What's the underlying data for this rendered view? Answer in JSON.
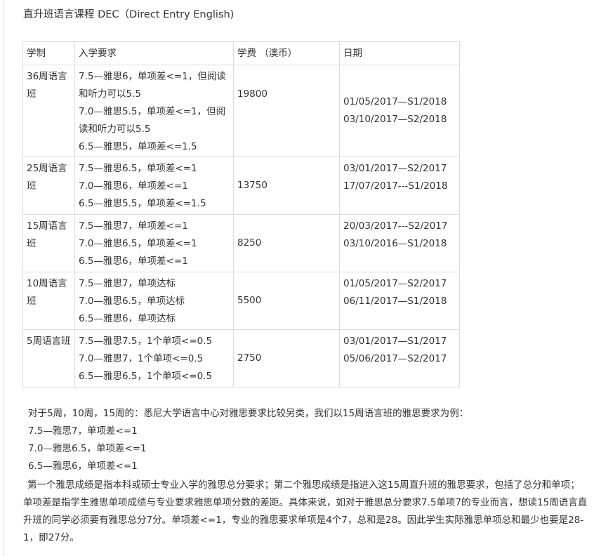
{
  "title": "直升班语言课程 DEC（Direct Entry English)",
  "table": {
    "headers": [
      "学制",
      "入学要求",
      "学费 （澳币）",
      "日期"
    ],
    "rows": [
      {
        "duration": "36周语言班",
        "requirements": [
          "7.5—雅思6，单项差<=1，但阅读和听力可以5.5",
          "7.0—雅思5.5，单项差<=1，但阅读和听力可以5.5",
          "6.5—雅思5，单项差<=1.5"
        ],
        "fee": "19800",
        "dates": [
          "01/05/2017—S1/2018",
          "03/10/2017—S2/2018"
        ]
      },
      {
        "duration": "25周语言班",
        "requirements": [
          "7.5—雅思6.5，单项差<=1",
          "7.0—雅思6，单项差<=1",
          "6.5—雅思5.5，单项差<=1.5"
        ],
        "fee": "13750",
        "dates": [
          "03/01/2017—S2/2017",
          "17/07/2017---S1/2018"
        ]
      },
      {
        "duration": "15周语言班",
        "requirements": [
          "7.5—雅思7，单项差<=1",
          "7.0—雅思6.5，单项差<=1",
          "6.5—雅思6，单项差<=1"
        ],
        "fee": "8250",
        "dates": [
          "20/03/2017---S2/2017",
          "03/10/2016—S1/2018"
        ]
      },
      {
        "duration": "10周语言班",
        "requirements": [
          "7.5—雅思7，单项达标",
          "7.0—雅思6.5，单项达标",
          "6.5—雅思6，单项达标"
        ],
        "fee": "5500",
        "dates": [
          "01/05/2017—S2/2017",
          "06/11/2017—S1/2018"
        ]
      },
      {
        "duration": "5周语言班",
        "requirements": [
          "7.5—雅思7.5，1个单项<=0.5",
          "7.0—雅思7，1个单项<=0.5",
          "6.5—雅思6.5，1个单项<=0.5"
        ],
        "fee": "2750",
        "dates": [
          "03/01/2017—S1/2017",
          "05/06/2017—S2/2017"
        ]
      }
    ]
  },
  "paragraphs": {
    "intro": "对于5周，10周，15周的：悉尼大学语言中心对雅思要求比较另类，我们以15周语言班的雅思要求为例：",
    "example_lines": [
      "7.5—雅思7，单项差<=1",
      "7.0—雅思6.5，单项差<=1",
      "6.5—雅思6，单项差<=1"
    ],
    "explanation": "第一个雅思成绩是指本科或硕士专业入学的雅思总分要求；第二个雅思成绩是指进入这15周直升班的雅思要求，包括了总分和单项；单项差是指学生雅思单项成绩与专业要求雅思单项分数的差距。具体来说，如对于雅思总分要求7.5单项7的专业而言，想读15周语言直升班的同学必须要有雅思总分7分。单项差<=1，专业的雅思要求单项是4个7，总和是28。因此学生实际雅思单项总和最少也要是28-1，即27分。"
  }
}
